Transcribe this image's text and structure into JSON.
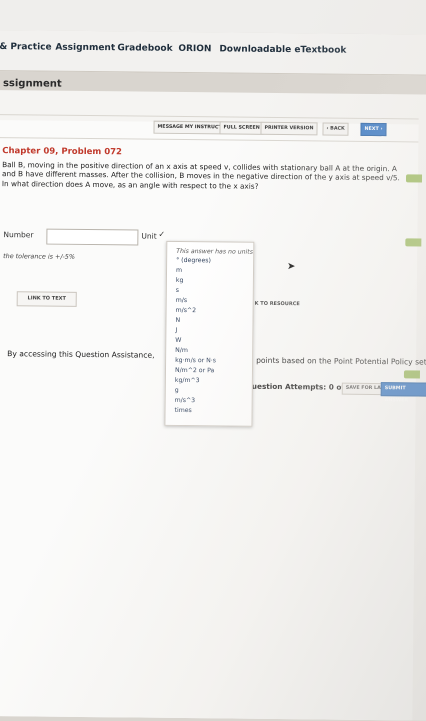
{
  "nav": {
    "tabs": [
      "& Practice",
      "Assignment",
      "Gradebook",
      "ORION",
      "Downloadable eTextbook"
    ]
  },
  "section_title": "ssignment",
  "toolbar": {
    "message": "MESSAGE MY INSTRUCTOR",
    "full_screen": "FULL SCREEN",
    "printer": "PRINTER VERSION",
    "back": "‹ BACK",
    "next": "NEXT ›"
  },
  "problem": {
    "chapter": "Chapter 09, Problem 072",
    "text": "Ball B, moving in the positive direction of an x axis at speed v, collides with stationary ball A at the origin. A and B have different masses. After the collision, B moves in the negative direction of the y axis at speed v/5. In what direction does A move, as an angle with respect to the x axis?"
  },
  "answer": {
    "number_label": "Number",
    "number_value": "",
    "unit_label": "Unit",
    "unit_options": [
      "This answer has no units",
      "° (degrees)",
      "m",
      "kg",
      "s",
      "m/s",
      "m/s^2",
      "N",
      "J",
      "W",
      "N/m",
      "kg·m/s or N·s",
      "N/m^2 or Pa",
      "kg/m^3",
      "g",
      "m/s^3",
      "times"
    ],
    "tolerance": "the tolerance is +/-5%"
  },
  "links": {
    "link_to_text": "LINK TO TEXT",
    "resource_partial": "K TO RESOURCE"
  },
  "footer": {
    "access_text": "By accessing this Question Assistance,",
    "points_text": "points based on the Point Potential Policy set by your instructor.",
    "attempts_text": "uestion Attempts: 0 of 6 used",
    "save_later": "SAVE FOR LATER",
    "submit": "SUBMIT ANSWER"
  },
  "colors": {
    "chapter_red": "#c0392b",
    "primary_blue": "#3e7cc6",
    "side_tab_green": "#9fbd63"
  }
}
